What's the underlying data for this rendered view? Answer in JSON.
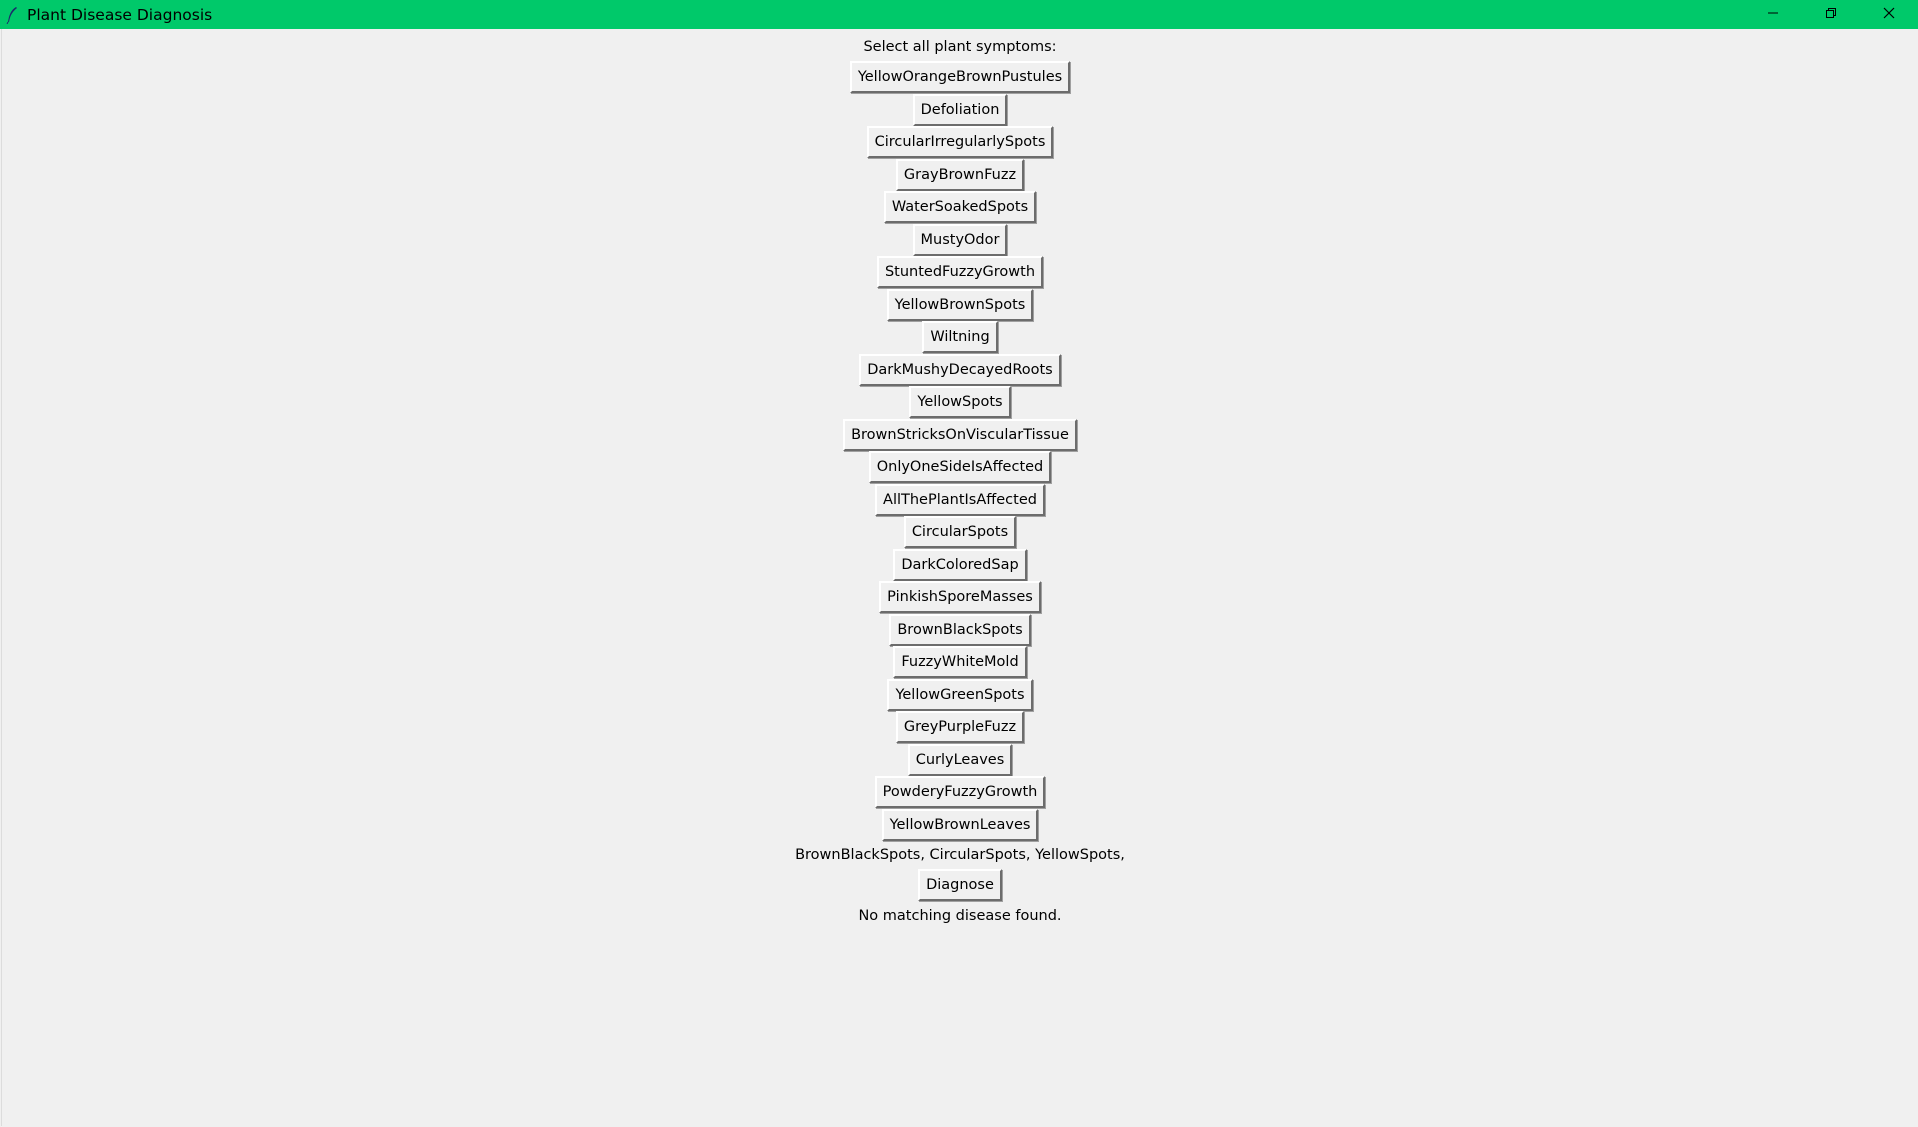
{
  "window": {
    "title": "Plant Disease Diagnosis",
    "icon": "feather-icon",
    "controls": [
      "minimize-icon",
      "restore-icon",
      "close-icon"
    ],
    "titlebar_color": "#00c96a"
  },
  "prompt": "Select all plant symptoms:",
  "symptoms": [
    "YellowOrangeBrownPustules",
    "Defoliation",
    "CircularIrregularlySpots",
    "GrayBrownFuzz",
    "WaterSoakedSpots",
    "MustyOdor",
    "StuntedFuzzyGrowth",
    "YellowBrownSpots",
    "Wiltning",
    "DarkMushyDecayedRoots",
    "YellowSpots",
    "BrownStricksOnViscularTissue",
    "OnlyOneSideIsAffected",
    "AllThePlantIsAffected",
    "CircularSpots",
    "DarkColoredSap",
    "PinkishSporeMasses",
    "BrownBlackSpots",
    "FuzzyWhiteMold",
    "YellowGreenSpots",
    "GreyPurpleFuzz",
    "CurlyLeaves",
    "PowderyFuzzyGrowth",
    "YellowBrownLeaves"
  ],
  "selected_text": "BrownBlackSpots, CircularSpots, YellowSpots,",
  "diagnose_label": "Diagnose",
  "result_text": "No matching disease found."
}
